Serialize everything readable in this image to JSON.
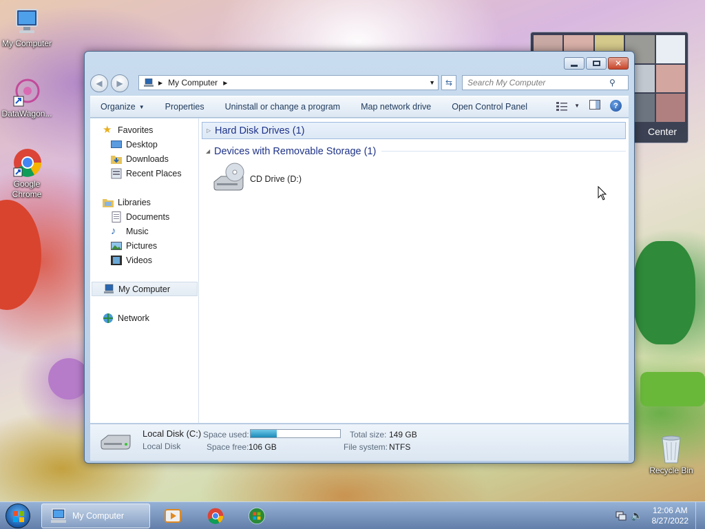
{
  "desktop": {
    "icons": [
      {
        "label": "My Computer"
      },
      {
        "label": "DataWagon..."
      },
      {
        "label": "Google Chrome"
      },
      {
        "label": "Recycle Bin"
      }
    ],
    "widget_label": "Center"
  },
  "window": {
    "address": {
      "segment": "My Computer"
    },
    "search": {
      "placeholder": "Search My Computer"
    },
    "toolbar": {
      "organize": "Organize",
      "properties": "Properties",
      "uninstall": "Uninstall or change a program",
      "map_drive": "Map network drive",
      "control_panel": "Open Control Panel"
    },
    "nav": {
      "favorites": "Favorites",
      "desktop": "Desktop",
      "downloads": "Downloads",
      "recent": "Recent Places",
      "libraries": "Libraries",
      "documents": "Documents",
      "music": "Music",
      "pictures": "Pictures",
      "videos": "Videos",
      "my_computer": "My Computer",
      "network": "Network"
    },
    "groups": {
      "hdd": "Hard Disk Drives (1)",
      "removable": "Devices with Removable Storage (1)"
    },
    "drives": {
      "cd": "CD Drive (D:)"
    },
    "details": {
      "name": "Local Disk (C:)",
      "type": "Local Disk",
      "space_used_label": "Space used:",
      "space_used_fraction": 0.29,
      "space_free_label": "Space free:",
      "space_free": "106 GB",
      "total_label": "Total size:",
      "total": "149 GB",
      "fs_label": "File system:",
      "fs": "NTFS"
    }
  },
  "taskbar": {
    "active_window": "My Computer",
    "time": "12:06 AM",
    "date": "8/27/2022"
  },
  "colors": {
    "accent": "#1e3287",
    "progress": "#1b8ab8"
  }
}
